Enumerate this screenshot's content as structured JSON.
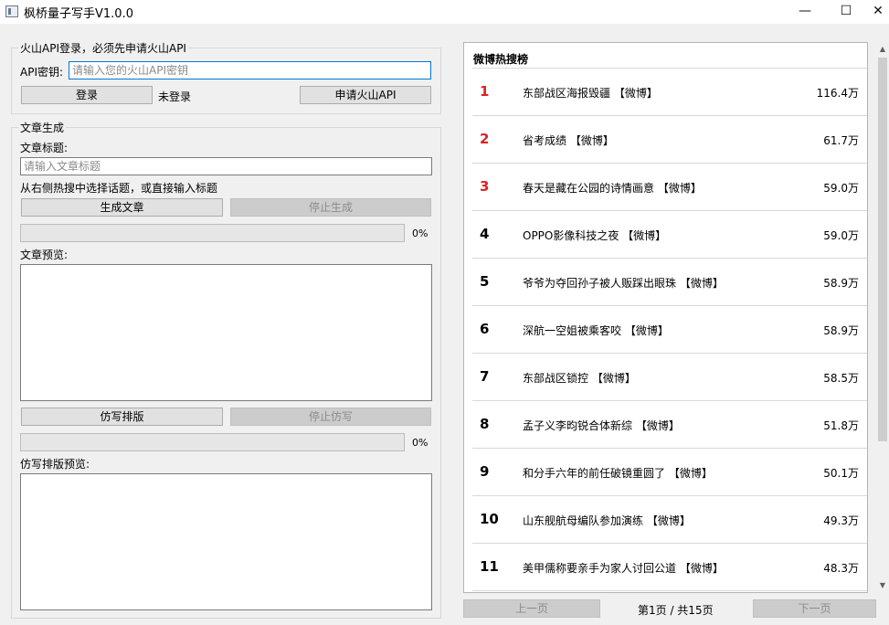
{
  "window": {
    "title": "枫桥量子写手V1.0.0",
    "minimize_glyph": "—",
    "maximize_glyph": "☐",
    "close_glyph": "✕"
  },
  "api_group": {
    "title": "火山API登录，必须先申请火山API",
    "key_label": "API密钥:",
    "key_value": "",
    "key_placeholder": "请输入您的火山API密钥",
    "login_label": "登录",
    "status_text": "未登录",
    "apply_label": "申请火山API"
  },
  "article_group": {
    "title": "文章生成",
    "title_label": "文章标题:",
    "title_value": "",
    "title_placeholder": "请输入文章标题",
    "hint": "从右侧热搜中选择话题，或直接输入标题",
    "generate_label": "生成文章",
    "stop_generate_label": "停止生成",
    "progress": 0,
    "progress_text": "0%",
    "preview_label": "文章预览:",
    "preview_text": "",
    "imitate_label": "仿写排版",
    "stop_imitate_label": "停止仿写",
    "imitate_progress": 0,
    "imitate_progress_text": "0%",
    "imitate_preview_label": "仿写排版预览:",
    "imitate_preview_text": ""
  },
  "hot_search": {
    "title": "微博热搜榜",
    "items": [
      {
        "rank": "1",
        "text": "东部战区海报毁疆 【微博】",
        "count": "116.4万"
      },
      {
        "rank": "2",
        "text": "省考成绩 【微博】",
        "count": "61.7万"
      },
      {
        "rank": "3",
        "text": "春天是藏在公园的诗情画意 【微博】",
        "count": "59.0万"
      },
      {
        "rank": "4",
        "text": "OPPO影像科技之夜 【微博】",
        "count": "59.0万"
      },
      {
        "rank": "5",
        "text": "爷爷为夺回孙子被人贩踩出眼珠 【微博】",
        "count": "58.9万"
      },
      {
        "rank": "6",
        "text": "深航一空姐被乘客咬 【微博】",
        "count": "58.9万"
      },
      {
        "rank": "7",
        "text": "东部战区锁控 【微博】",
        "count": "58.5万"
      },
      {
        "rank": "8",
        "text": "孟子义李昀锐合体新综 【微博】",
        "count": "51.8万"
      },
      {
        "rank": "9",
        "text": "和分手六年的前任破镜重圆了 【微博】",
        "count": "50.1万"
      },
      {
        "rank": "10",
        "text": "山东舰航母编队参加演练 【微博】",
        "count": "49.3万"
      },
      {
        "rank": "11",
        "text": "美甲儒称要亲手为家人讨回公道 【微博】",
        "count": "48.3万"
      }
    ],
    "highlight_color": "#e02020"
  },
  "pagination": {
    "prev_label": "上一页",
    "page_info": "第1页 / 共15页",
    "next_label": "下一页"
  }
}
